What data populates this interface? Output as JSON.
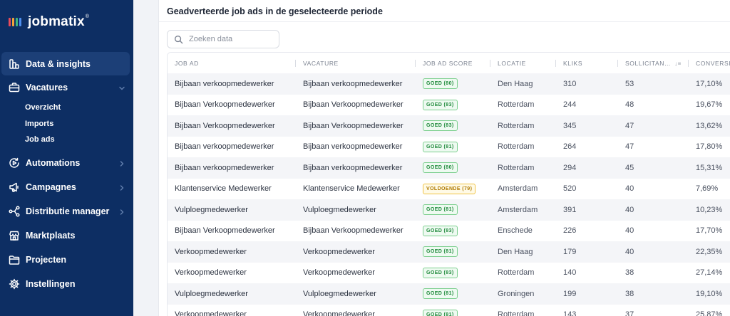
{
  "app": {
    "name": "jobmatix",
    "trademark": "®",
    "brand_bar_colors": [
      "#e94b5b",
      "#f2a33a",
      "#3fb57e",
      "#4d8ef0"
    ]
  },
  "sidebar": {
    "items": [
      {
        "label": "Data & insights",
        "icon": "chart-icon",
        "active": true,
        "chevron": false
      },
      {
        "label": "Vacatures",
        "icon": "briefcase-icon",
        "active": false,
        "chevron": "down"
      },
      {
        "label": "Automations",
        "icon": "play-cycle-icon",
        "active": false,
        "chevron": "right"
      },
      {
        "label": "Campagnes",
        "icon": "megaphone-icon",
        "active": false,
        "chevron": "right"
      },
      {
        "label": "Distributie manager",
        "icon": "share-nodes-icon",
        "active": false,
        "chevron": "right"
      },
      {
        "label": "Marktplaats",
        "icon": "store-icon",
        "active": false,
        "chevron": false
      },
      {
        "label": "Projecten",
        "icon": "folder-icon",
        "active": false,
        "chevron": false
      },
      {
        "label": "Instellingen",
        "icon": "gear-icon",
        "active": false,
        "chevron": false
      }
    ],
    "vacatures_sub": [
      "Overzicht",
      "Imports",
      "Job ads"
    ]
  },
  "main": {
    "title": "Geadverteerde job ads in de geselecteerde periode",
    "search_placeholder": "Zoeken data",
    "columns": [
      "JOB AD",
      "VACATURE",
      "JOB AD SCORE",
      "LOCATIE",
      "KLIKS",
      "SOLLICITAN…",
      "CONVERSIE"
    ],
    "rows": [
      {
        "job_ad": "Bijbaan verkoopmedewerker",
        "vacature": "Bijbaan verkoopmedewerker",
        "score": "GOED (80)",
        "status": "good",
        "locatie": "Den Haag",
        "kliks": "310",
        "sollicitanten": "53",
        "conversie": "17,10%"
      },
      {
        "job_ad": "Bijbaan Verkoopmedewerker",
        "vacature": "Bijbaan Verkoopmedewerker",
        "score": "GOED (83)",
        "status": "good",
        "locatie": "Rotterdam",
        "kliks": "244",
        "sollicitanten": "48",
        "conversie": "19,67%"
      },
      {
        "job_ad": "Bijbaan Verkoopmedewerker",
        "vacature": "Bijbaan Verkoopmedewerker",
        "score": "GOED (83)",
        "status": "good",
        "locatie": "Rotterdam",
        "kliks": "345",
        "sollicitanten": "47",
        "conversie": "13,62%"
      },
      {
        "job_ad": "Bijbaan verkoopmedewerker",
        "vacature": "Bijbaan verkoopmedewerker",
        "score": "GOED (81)",
        "status": "good",
        "locatie": "Rotterdam",
        "kliks": "264",
        "sollicitanten": "47",
        "conversie": "17,80%"
      },
      {
        "job_ad": "Bijbaan verkoopmedewerker",
        "vacature": "Bijbaan verkoopmedewerker",
        "score": "GOED (80)",
        "status": "good",
        "locatie": "Rotterdam",
        "kliks": "294",
        "sollicitanten": "45",
        "conversie": "15,31%"
      },
      {
        "job_ad": "Klantenservice Medewerker",
        "vacature": "Klantenservice Medewerker",
        "score": "VOLDOENDE (79)",
        "status": "warn",
        "locatie": "Amsterdam",
        "kliks": "520",
        "sollicitanten": "40",
        "conversie": "7,69%"
      },
      {
        "job_ad": "Vulploegmedewerker",
        "vacature": "Vulploegmedewerker",
        "score": "GOED (81)",
        "status": "good",
        "locatie": "Amsterdam",
        "kliks": "391",
        "sollicitanten": "40",
        "conversie": "10,23%"
      },
      {
        "job_ad": "Bijbaan Verkoopmedewerker",
        "vacature": "Bijbaan Verkoopmedewerker",
        "score": "GOED (83)",
        "status": "good",
        "locatie": "Enschede",
        "kliks": "226",
        "sollicitanten": "40",
        "conversie": "17,70%"
      },
      {
        "job_ad": "Verkoopmedewerker",
        "vacature": "Verkoopmedewerker",
        "score": "GOED (81)",
        "status": "good",
        "locatie": "Den Haag",
        "kliks": "179",
        "sollicitanten": "40",
        "conversie": "22,35%"
      },
      {
        "job_ad": "Verkoopmedewerker",
        "vacature": "Verkoopmedewerker",
        "score": "GOED (83)",
        "status": "good",
        "locatie": "Rotterdam",
        "kliks": "140",
        "sollicitanten": "38",
        "conversie": "27,14%"
      },
      {
        "job_ad": "Vulploegmedewerker",
        "vacature": "Vulploegmedewerker",
        "score": "GOED (81)",
        "status": "good",
        "locatie": "Groningen",
        "kliks": "199",
        "sollicitanten": "38",
        "conversie": "19,10%"
      },
      {
        "job_ad": "Verkoopmedewerker",
        "vacature": "Verkoopmedewerker",
        "score": "GOED (81)",
        "status": "good",
        "locatie": "Rotterdam",
        "kliks": "143",
        "sollicitanten": "37",
        "conversie": "25,87%"
      }
    ]
  }
}
